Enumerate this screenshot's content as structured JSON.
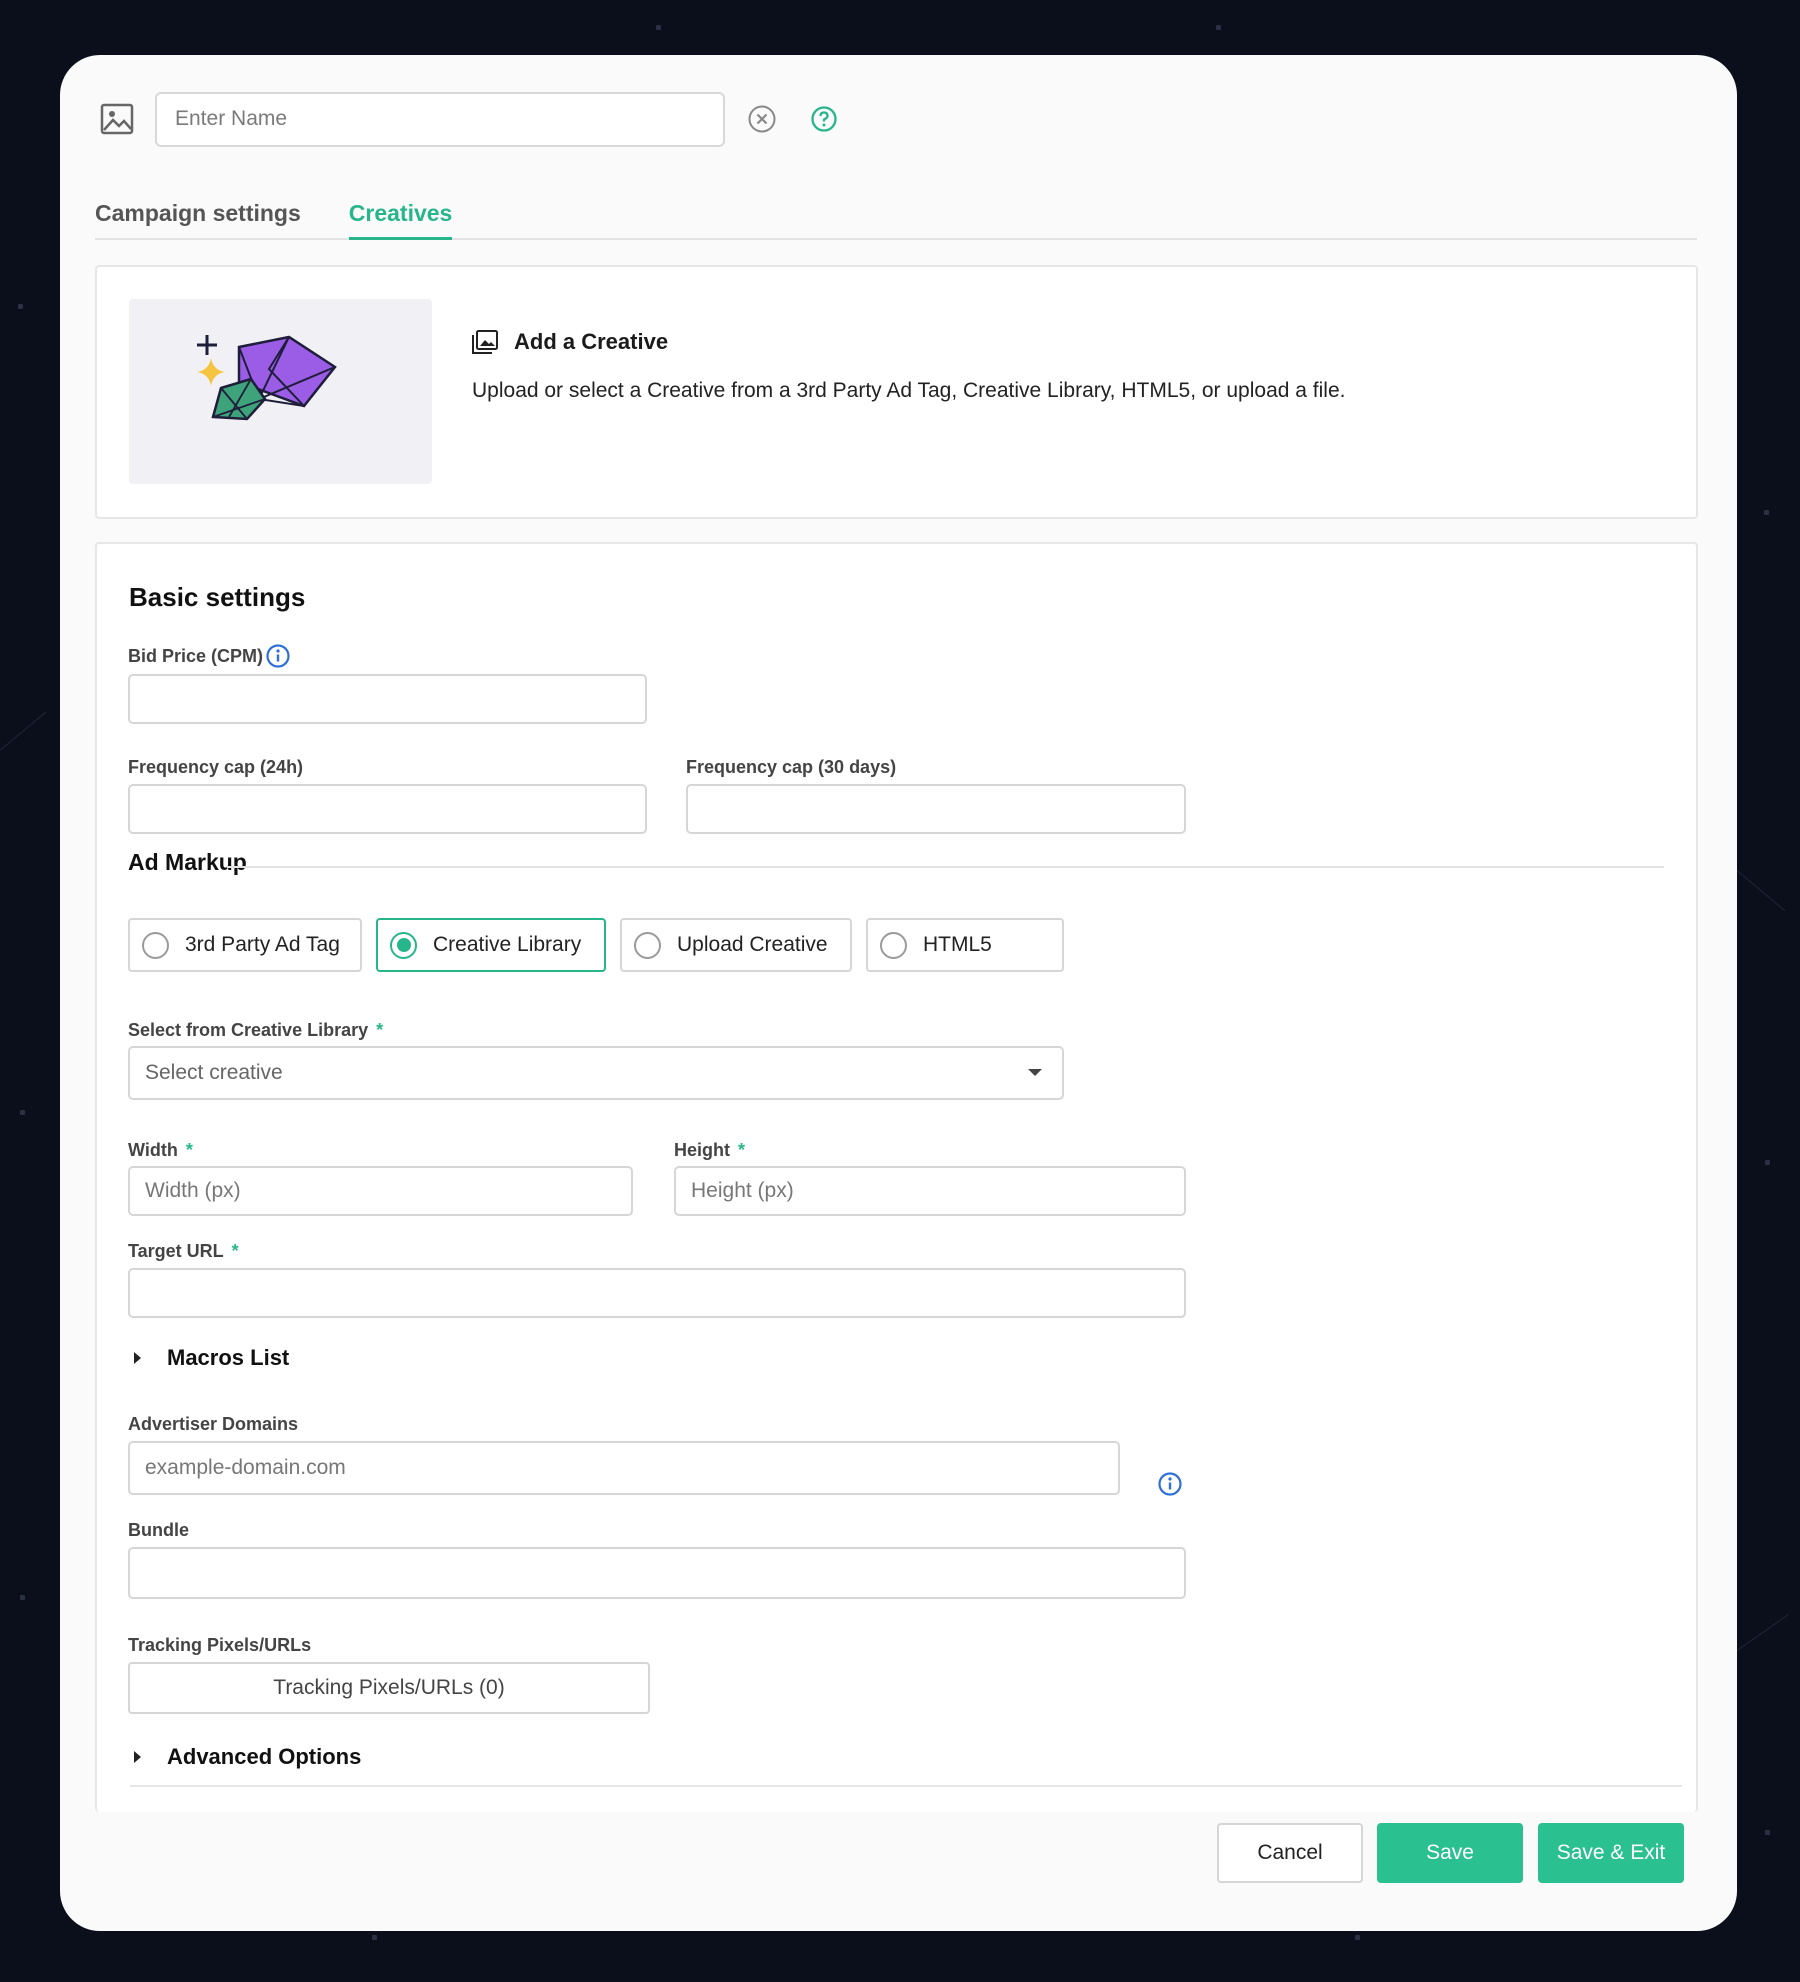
{
  "header": {
    "name_placeholder": "Enter Name"
  },
  "tabs": [
    {
      "label": "Campaign settings",
      "active": false
    },
    {
      "label": "Creatives",
      "active": true
    }
  ],
  "add_creative": {
    "title": "Add a Creative",
    "description": "Upload or select a Creative from a 3rd Party Ad Tag, Creative Library, HTML5, or upload a file."
  },
  "basic_settings": {
    "title": "Basic settings",
    "bid_price_label": "Bid Price (CPM)",
    "freq_24h_label": "Frequency cap (24h)",
    "freq_30d_label": "Frequency cap (30 days)"
  },
  "ad_markup": {
    "title": "Ad Markup",
    "options": [
      {
        "label": "3rd Party Ad Tag",
        "selected": false
      },
      {
        "label": "Creative Library",
        "selected": true
      },
      {
        "label": "Upload Creative",
        "selected": false
      },
      {
        "label": "HTML5",
        "selected": false
      }
    ],
    "select_label": "Select from Creative Library",
    "select_value": "Select creative",
    "width_label": "Width",
    "width_placeholder": "Width (px)",
    "height_label": "Height",
    "height_placeholder": "Height (px)",
    "target_url_label": "Target URL",
    "required_mark": "*"
  },
  "macros_label": "Macros List",
  "advertiser_domains": {
    "label": "Advertiser Domains",
    "placeholder": "example-domain.com"
  },
  "bundle_label": "Bundle",
  "tracking": {
    "label": "Tracking Pixels/URLs",
    "button": "Tracking Pixels/URLs (0)"
  },
  "advanced_label": "Advanced Options",
  "footer": {
    "cancel": "Cancel",
    "save": "Save",
    "save_exit": "Save & Exit"
  },
  "colors": {
    "accent": "#27b58a",
    "info": "#2f6fd6",
    "background": "#0b0f1c"
  }
}
